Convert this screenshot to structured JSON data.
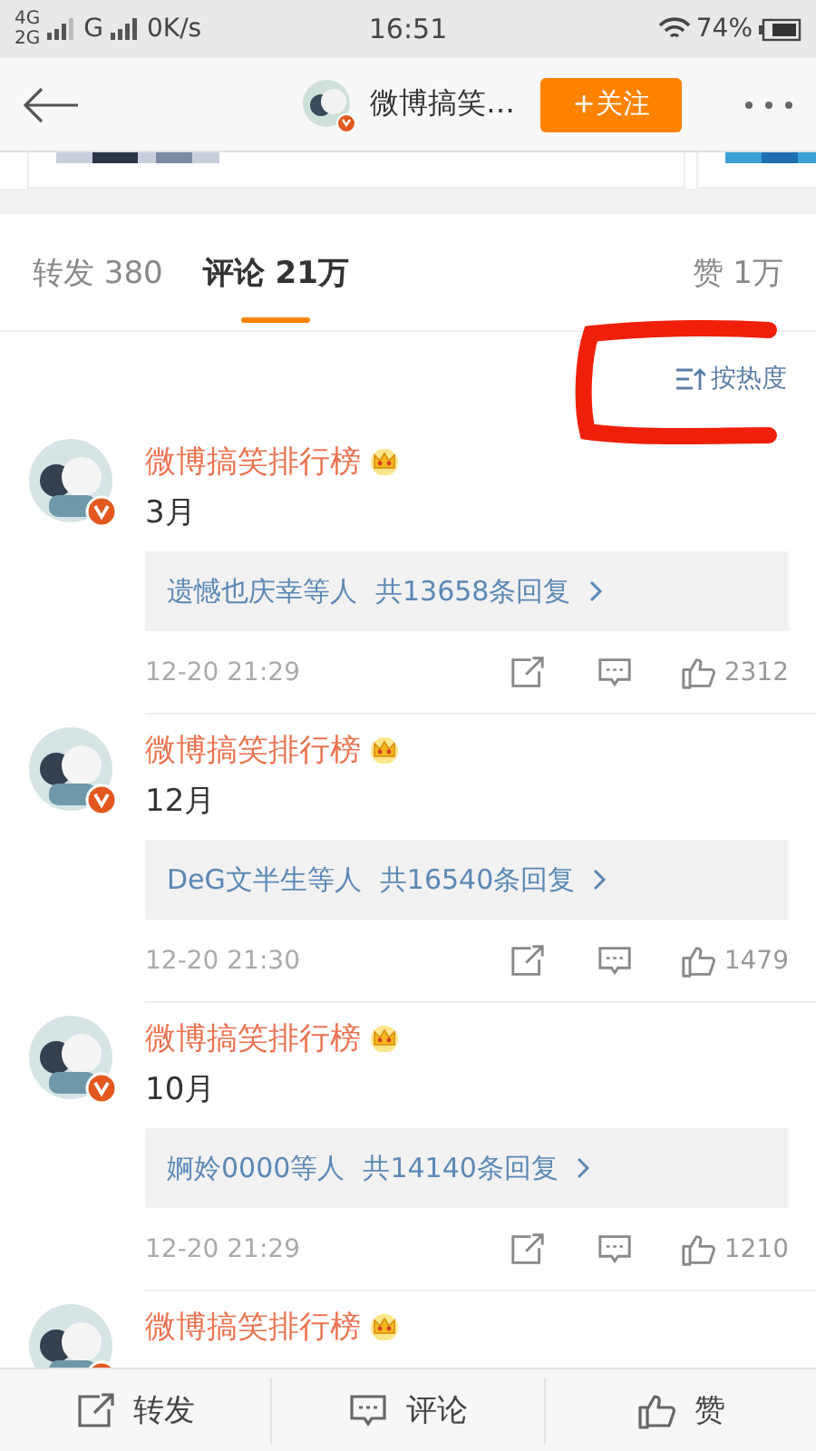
{
  "status_bar": {
    "network_top": "4G",
    "network_bottom": "2G",
    "network_second": "G",
    "speed": "0K/s",
    "time": "16:51",
    "battery": "74%"
  },
  "header": {
    "title": "微博搞笑…",
    "follow_button": "+关注"
  },
  "tabs": [
    {
      "label": "转发 380",
      "selected": false
    },
    {
      "label": "评论 21万",
      "selected": true
    },
    {
      "label": "赞 1万",
      "selected": false
    }
  ],
  "sort": {
    "label": "按热度"
  },
  "comments": [
    {
      "author": "微博搞笑排行榜",
      "text": "3月",
      "replies_by": "遗憾也庆幸等人",
      "replies_count": "共13658条回复",
      "time": "12-20 21:29",
      "likes": "2312"
    },
    {
      "author": "微博搞笑排行榜",
      "text": "12月",
      "replies_by": "DeG文半生等人",
      "replies_count": "共16540条回复",
      "time": "12-20 21:30",
      "likes": "1479"
    },
    {
      "author": "微博搞笑排行榜",
      "text": "10月",
      "replies_by": "婀姈0000等人",
      "replies_count": "共14140条回复",
      "time": "12-20 21:29",
      "likes": "1210"
    },
    {
      "author": "微博搞笑排行榜"
    }
  ],
  "bottom_bar": [
    {
      "kind": "share",
      "label": "转发"
    },
    {
      "kind": "comment",
      "label": "评论"
    },
    {
      "kind": "like",
      "label": "赞"
    }
  ]
}
